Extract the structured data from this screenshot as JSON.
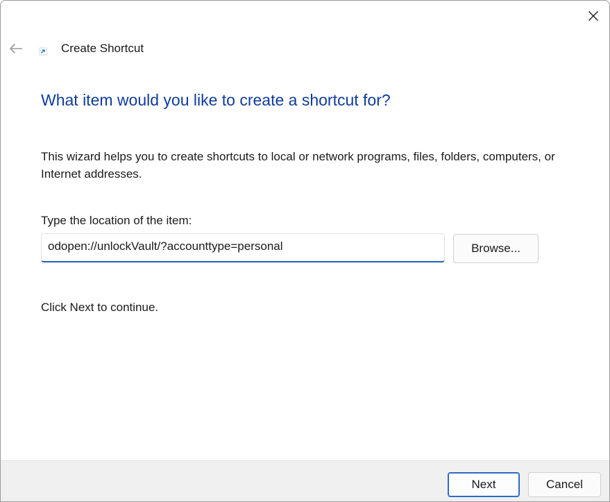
{
  "window": {
    "title": "Create Shortcut",
    "close_icon": "close-icon",
    "back_icon": "back-arrow-icon",
    "title_icon": "shortcut-icon"
  },
  "main": {
    "heading": "What item would you like to create a shortcut for?",
    "description": "This wizard helps you to create shortcuts to local or network programs, files, folders, computers, or Internet addresses.",
    "location_label": "Type the location of the item:",
    "location_value": "odopen://unlockVault/?accounttype=personal",
    "browse_label": "Browse...",
    "continue_text": "Click Next to continue."
  },
  "footer": {
    "next_label": "Next",
    "cancel_label": "Cancel"
  },
  "colors": {
    "heading": "#0f3c9c",
    "accent": "#1f5fbf",
    "footer_bg": "#f0f0f0"
  }
}
